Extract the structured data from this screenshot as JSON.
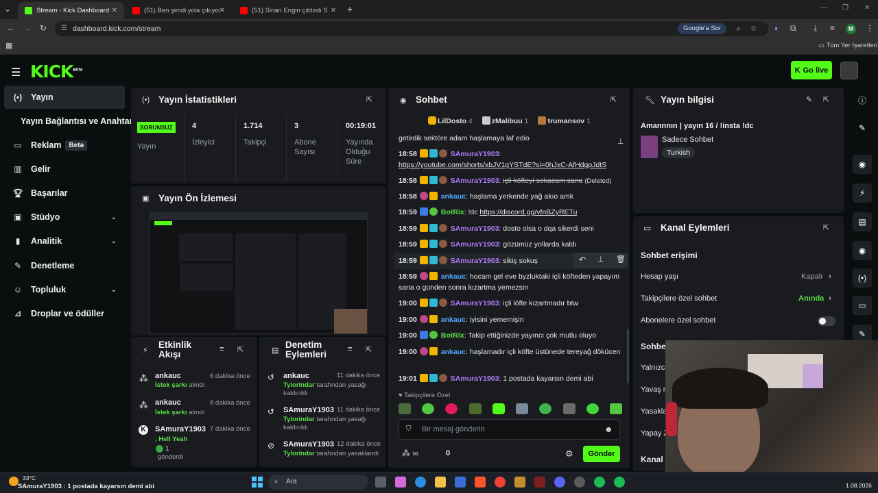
{
  "browser": {
    "tabs": [
      {
        "title": "Stream - Kick Dashboard",
        "active": true
      },
      {
        "title": "(51) Ben şimdi yola çıkıyom da..."
      },
      {
        "title": "(51) Sinan Engin çıldırdı Seyret..."
      }
    ],
    "new_tab": "+",
    "url": "dashboard.kick.com/stream",
    "google_btn": "Google'a Sor",
    "bookmarks_label": "Tüm Yer İşaretleri",
    "profile_initial": "M"
  },
  "kick": {
    "logo": "KICK",
    "logo_beta": "BETA",
    "go_live": "Go live"
  },
  "sidebar": {
    "items": [
      {
        "label": "Yayın",
        "icon": "broadcast-icon"
      },
      {
        "label": "Yayın Bağlantısı ve Anahtarı"
      },
      {
        "label": "Reklam",
        "badge": "Beta",
        "icon": "ad-icon"
      },
      {
        "label": "Gelir",
        "icon": "bar-chart-icon"
      },
      {
        "label": "Başarılar",
        "icon": "trophy-icon"
      },
      {
        "label": "Stüdyo",
        "icon": "tv-icon"
      },
      {
        "label": "Analitik",
        "icon": "bar-chart-icon"
      },
      {
        "label": "Denetleme",
        "icon": "wrench-icon"
      },
      {
        "label": "Topluluk",
        "icon": "people-icon"
      },
      {
        "label": "Droplar ve ödüller",
        "icon": "chart-icon"
      }
    ]
  },
  "stats": {
    "title": "Yayın İstatistikleri",
    "status_badge": "SORUNSUZ",
    "status_label": "Yayın",
    "viewers": "4",
    "viewers_label": "İzleyici",
    "followers": "1.714",
    "followers_label": "Takipçi",
    "subs": "3",
    "subs_label": "Abone Sayısı",
    "uptime": "00:19:01",
    "uptime_label": "Yayında Olduğu Süre"
  },
  "preview": {
    "title": "Yayın Ön İzlemesi"
  },
  "activity": {
    "title": "Etkinlik Akışı",
    "items": [
      {
        "name": "ankauc",
        "action": "İstek şarkı",
        "suffix": "alındı",
        "time": "6 dakika önce"
      },
      {
        "name": "ankauc",
        "action": "İstek şarkı",
        "suffix": "alındı",
        "time": "8 dakika önce"
      },
      {
        "name": "SAmuraY1903",
        "action": "Hell Yeah",
        "count": "1",
        "suffix": "gönderdi",
        "time": "7 dakika önce"
      }
    ]
  },
  "mod": {
    "title": "Denetim Eylemleri",
    "items": [
      {
        "name": "ankauc",
        "by": "Tylorindar",
        "text": "tarafından yasağı kaldırıldı",
        "time": "11 dakika önce"
      },
      {
        "name": "SAmuraY1903",
        "by": "Tylorindar",
        "text": "tarafından yasağı kaldırıldı",
        "time": "11 dakika önce"
      },
      {
        "name": "SAmuraY1903",
        "by": "Tylorindar",
        "text": "tarafından yasaklandı",
        "time": "12 dakika önce"
      }
    ]
  },
  "chat": {
    "title": "Sohbet",
    "top_gifters": [
      {
        "name": "LilDosto",
        "count": "4"
      },
      {
        "name": "zMalibuu",
        "count": "1"
      },
      {
        "name": "trumansov",
        "count": "1"
      }
    ],
    "cut_line": "getirdik sektöre adam haşlamaya laf edio",
    "messages": [
      {
        "time": "18:58",
        "user": "SAmuraY1903",
        "text": "https://youtube.com/shorts/xbJV1gYSTdE?si=0hJxC-AfHdgpJdtS"
      },
      {
        "time": "18:58",
        "user": "SAmuraY1903",
        "text": "içli köfteyi sokacam sana",
        "deleted": "(Deleted)"
      },
      {
        "time": "18:58",
        "user": "ankauc",
        "text": "haşlama yerkende yağ akıo amk"
      },
      {
        "time": "18:59",
        "user": "BotRix",
        "text": "!dc",
        "link": "https://discord.gg/vfnBZyRETu"
      },
      {
        "time": "18:59",
        "user": "SAmuraY1903",
        "text": "dosto olsa o dqa sikerdi seni"
      },
      {
        "time": "18:59",
        "user": "SAmuraY1903",
        "text": "gözümüz yollarda kaldı"
      },
      {
        "time": "18:59",
        "user": "SAmuraY1903",
        "text": "sikiş sokuş"
      },
      {
        "time": "18:59",
        "user": "ankauc",
        "text": "hocam gel eve byzluktaki içli köfteden yapayım sana o günden sonra kızartma yemezsin"
      },
      {
        "time": "19:00",
        "user": "SAmuraY1903",
        "text": "içli löfte kızartmadır btw"
      },
      {
        "time": "19:00",
        "user": "ankauc",
        "text": "iyisini yememişin"
      },
      {
        "time": "19:00",
        "user": "BotRix",
        "text": "Takip ettiğinizde yayıncı çok mutlu oluyo"
      },
      {
        "time": "19:00",
        "user": "ankauc",
        "text": "haşlamadır içli köfte üstünede tereyağ dökücen"
      },
      {
        "time": "19:01",
        "user": "SAmuraY1903",
        "text": "1 postada kayarsın demi abi"
      }
    ],
    "followers_only": "Takipçilere Özel",
    "input_placeholder": "Bir mesaj gönderin",
    "points": "0",
    "send": "Gönder"
  },
  "info": {
    "title": "Yayın bilgisi",
    "stream_title": "Amannnın | yayın 16 / !insta !dc",
    "category": "Sadece Sohbet",
    "language": "Turkish"
  },
  "channel": {
    "title": "Kanal Eylemleri",
    "section": "Sohbet erişimi",
    "rows": [
      {
        "label": "Hesap yaşı",
        "value": "Kapalı"
      },
      {
        "label": "Takipçilere özel sohbet",
        "value": "Anında"
      },
      {
        "label": "Abonelere özel sohbet"
      }
    ],
    "partial": [
      "Sohbe",
      "Yalnızca",
      "Yavaş m",
      "Yasakla",
      "Yapay Z",
      "Kanal"
    ]
  },
  "taskbar": {
    "temp": "33°C",
    "ticker": "SAmuraY1903 : 1 postada kayarsın demi abi",
    "search": "Ara",
    "date": "1.08.2026"
  },
  "colors": {
    "kick_green": "#53fc18",
    "panel": "#191b1f",
    "bg": "#0b0e0f"
  }
}
